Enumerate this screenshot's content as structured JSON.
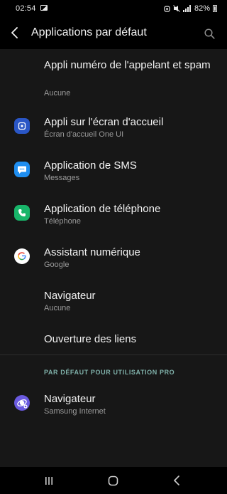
{
  "status_bar": {
    "time": "02:54",
    "battery": "82%"
  },
  "header": {
    "title": "Applications par défaut"
  },
  "items": [
    {
      "title": "Appli numéro de l'appelant et spam",
      "subtitle": "Aucune"
    },
    {
      "title": "Appli sur l'écran d'accueil",
      "subtitle": "Écran d'accueil One UI",
      "icon": "home-app-icon"
    },
    {
      "title": "Application de SMS",
      "subtitle": "Messages",
      "icon": "messages-icon"
    },
    {
      "title": "Application de téléphone",
      "subtitle": "Téléphone",
      "icon": "phone-icon"
    },
    {
      "title": "Assistant numérique",
      "subtitle": "Google",
      "icon": "google-icon"
    },
    {
      "title": "Navigateur",
      "subtitle": "Aucune"
    },
    {
      "title": "Ouverture des liens"
    }
  ],
  "work_section": {
    "header": "PAR DÉFAUT POUR UTILISATION PRO",
    "items": [
      {
        "title": "Navigateur",
        "subtitle": "Samsung Internet",
        "icon": "samsung-internet-icon"
      }
    ]
  },
  "colors": {
    "background": "#171717",
    "bars": "#000000",
    "section_accent": "#7fb0a9",
    "home_icon": "#2a56c6",
    "messages_icon": "#1f8ef0",
    "phone_icon": "#18b56a",
    "samsung_internet_icon": "#6a5ae0"
  }
}
